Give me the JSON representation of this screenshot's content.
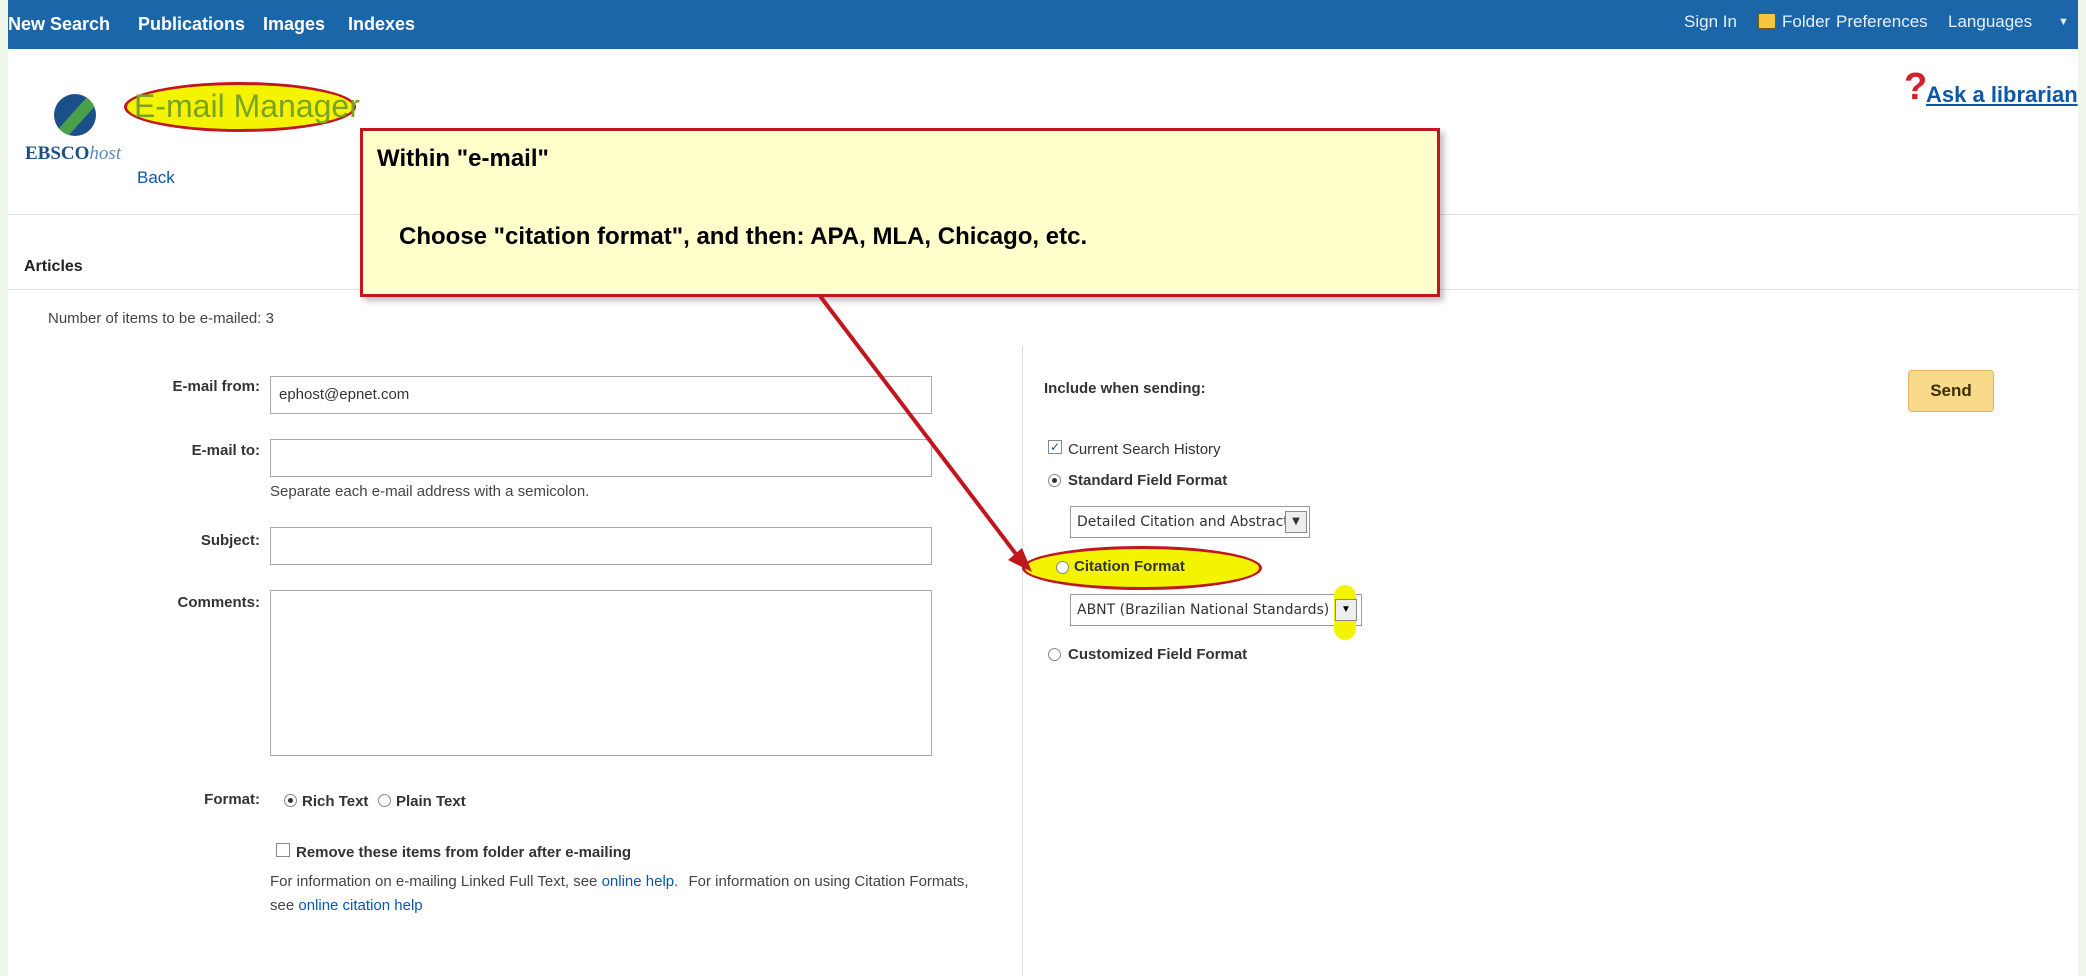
{
  "topnav": {
    "items": [
      "New Search",
      "Publications",
      "Images",
      "Indexes"
    ],
    "right": {
      "sign_in": "Sign In",
      "folder": "Folder",
      "preferences": "Preferences",
      "languages": "Languages"
    }
  },
  "header": {
    "title": "E-mail Manager",
    "brand": "EBSCO",
    "brand_suffix": "host",
    "back": "Back",
    "ask": "Ask a librarian"
  },
  "section_label": "Articles",
  "count_text": "Number of items to be e-mailed: 3",
  "form": {
    "from_label": "E-mail from:",
    "from_value": "ephost@epnet.com",
    "to_label": "E-mail to:",
    "to_value": "",
    "to_hint": "Separate each e-mail address with a semicolon.",
    "subject_label": "Subject:",
    "subject_value": "",
    "comments_label": "Comments:",
    "comments_value": "",
    "format_label": "Format:",
    "format_rich": "Rich Text",
    "format_plain": "Plain Text",
    "remove_label": "Remove these items from folder after e-mailing",
    "info_text_1": "For information on e-mailing Linked Full Text, see",
    "info_link_1": "online help.",
    "info_text_2": "For information on using Citation Formats,",
    "info_text_3": "see",
    "info_link_2": "online citation help"
  },
  "include": {
    "heading": "Include when sending:",
    "history": "Current Search History",
    "standard": "Standard Field Format",
    "standard_select": "Detailed Citation and Abstract",
    "citation": "Citation Format",
    "citation_select": "ABNT (Brazilian National Standards)",
    "customized": "Customized Field Format"
  },
  "send_label": "Send",
  "callout": {
    "title": "Within \"e-mail\"",
    "body": "Choose \"citation format\", and then: APA, MLA, Chicago, etc."
  },
  "colors": {
    "nav": "#1a66a8",
    "callout_bg": "#ffffcc",
    "callout_border": "#c0171e",
    "highlight": "#f4f400",
    "send_bg": "#f9d98a"
  }
}
